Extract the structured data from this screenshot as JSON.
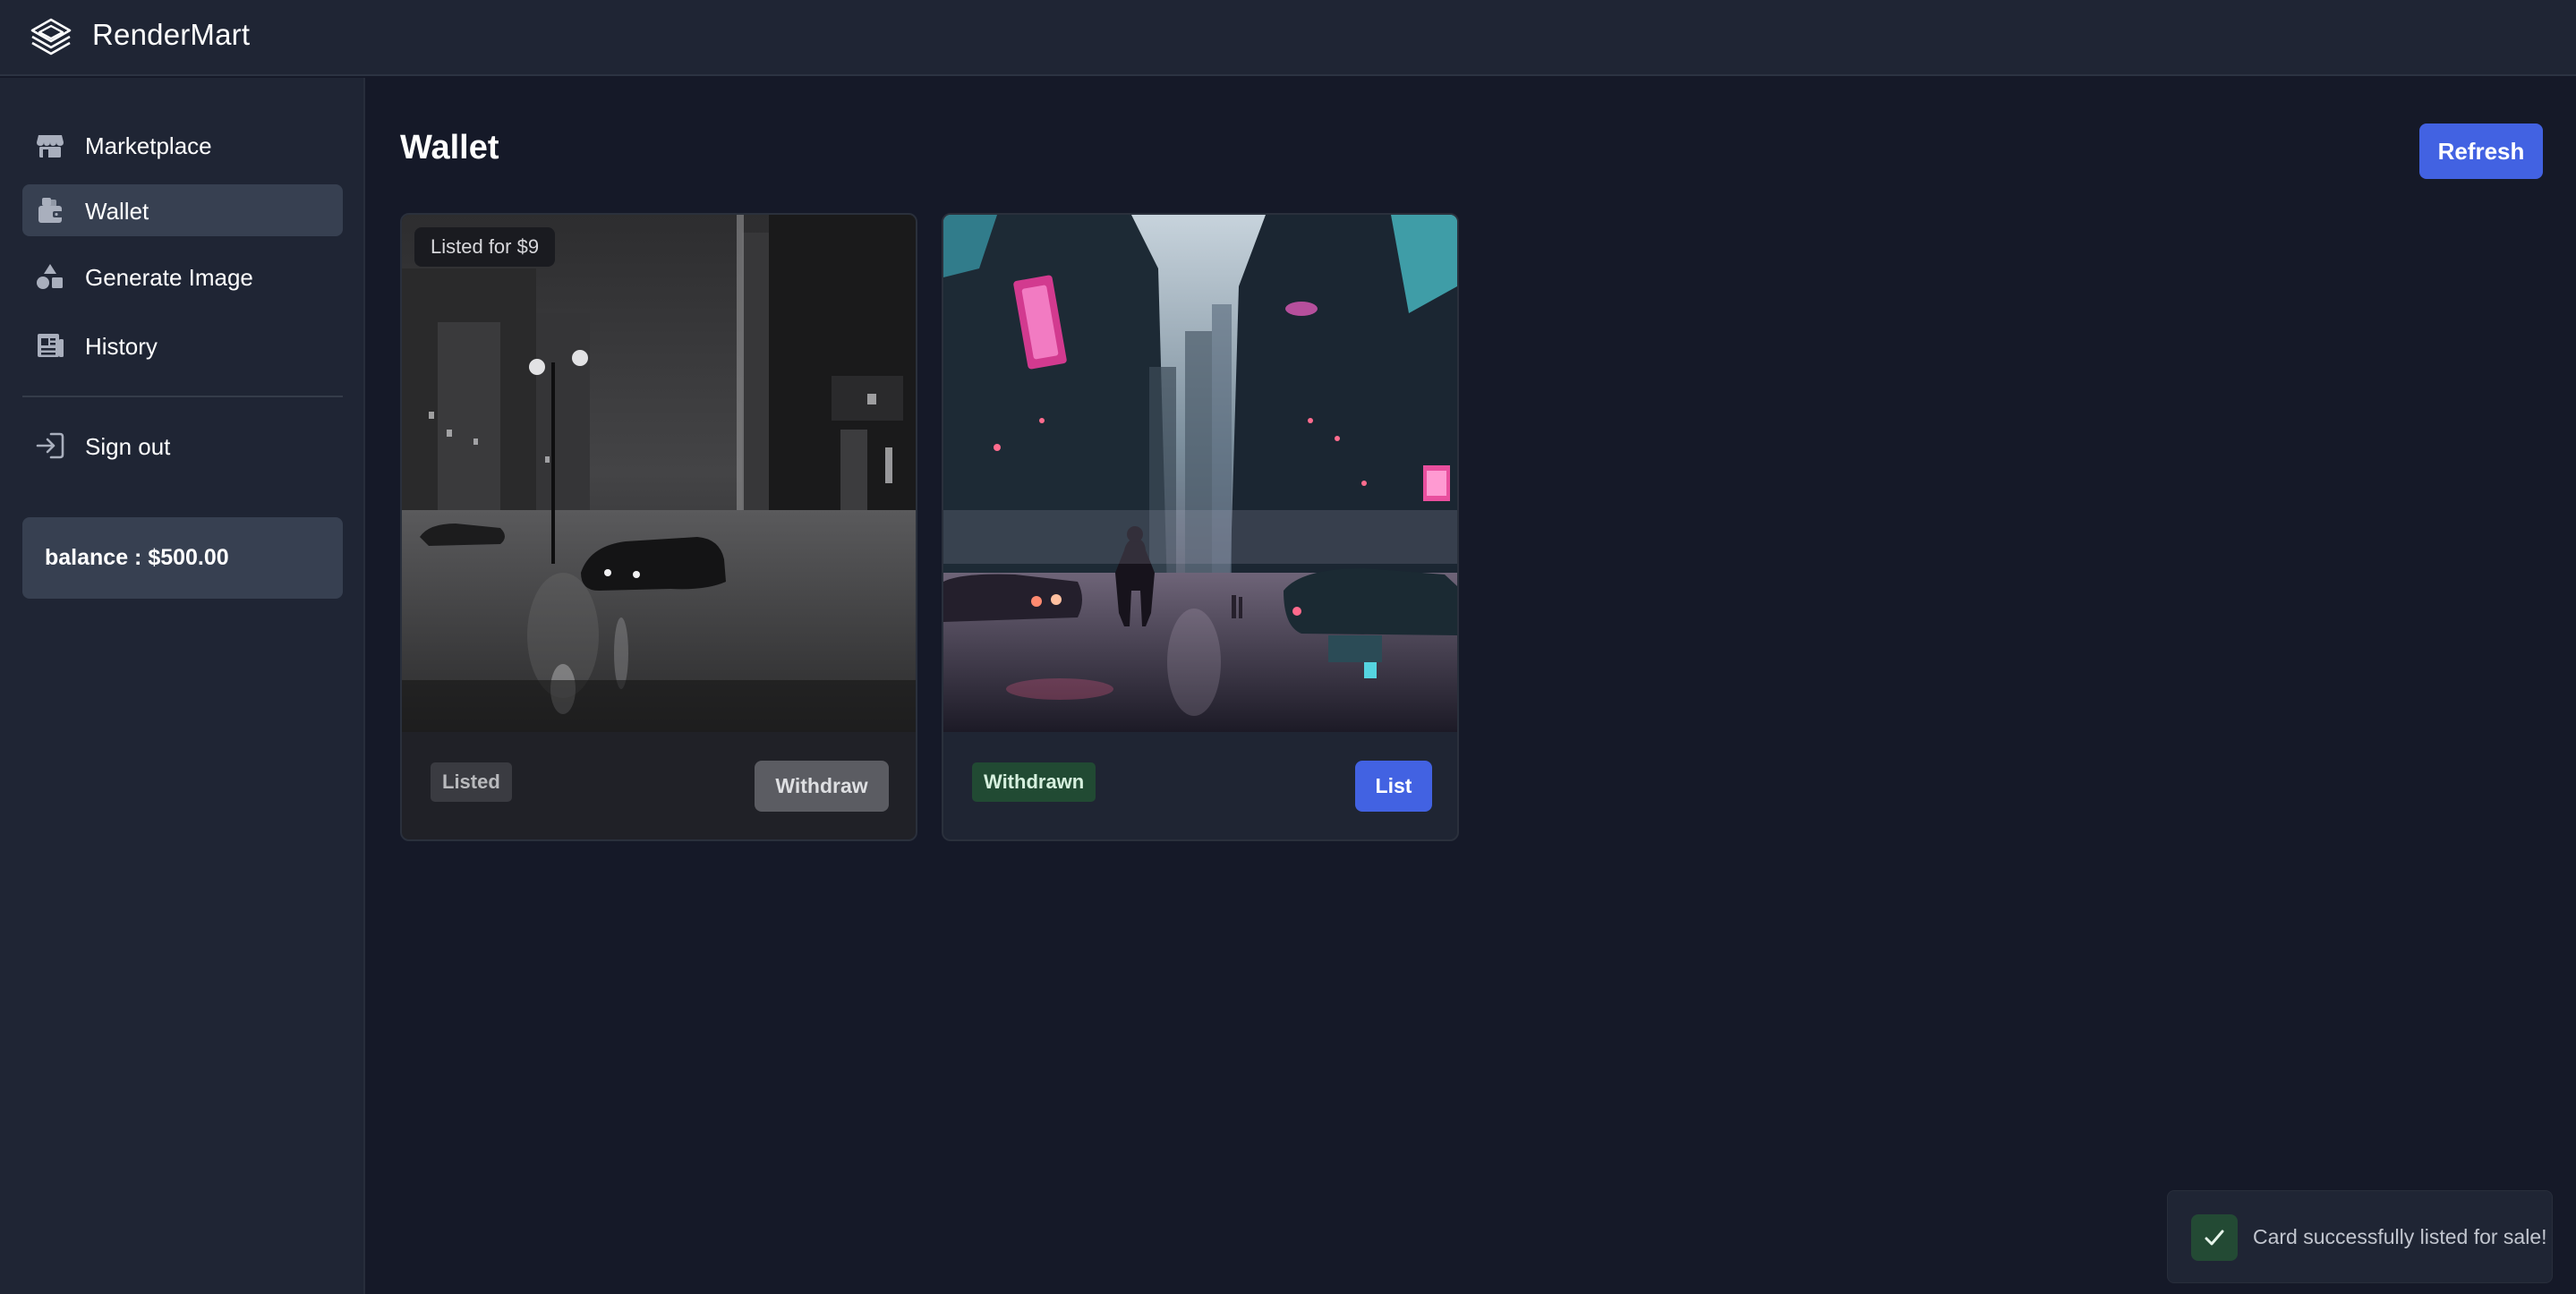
{
  "app": {
    "title": "RenderMart",
    "logo_icon": "layers-icon"
  },
  "sidebar": {
    "items": [
      {
        "label": "Marketplace",
        "icon": "store-icon",
        "active": false
      },
      {
        "label": "Wallet",
        "icon": "wallet-icon",
        "active": true
      },
      {
        "label": "Generate Image",
        "icon": "shapes-icon",
        "active": false
      },
      {
        "label": "History",
        "icon": "history-icon",
        "active": false
      }
    ],
    "sign_out": {
      "label": "Sign out",
      "icon": "sign-out-icon"
    },
    "balance": "balance : $500.00"
  },
  "main": {
    "title": "Wallet",
    "refresh_label": "Refresh",
    "cards": [
      {
        "image": "black-and-white rainy city street at night with car",
        "listed_tag": "Listed for $9",
        "status": "Listed",
        "action_label": "Withdraw"
      },
      {
        "image": "neon cyberpunk street with figure walking",
        "status": "Withdrawn",
        "action_label": "List"
      }
    ]
  },
  "toast": {
    "message": "Card successfully listed for sale!",
    "icon": "check-icon"
  },
  "colors": {
    "background": "#151928",
    "sidebar": "#1f2534",
    "accent": "#4262e2",
    "active_nav": "#374051",
    "withdrawn_badge": "#214a33"
  }
}
